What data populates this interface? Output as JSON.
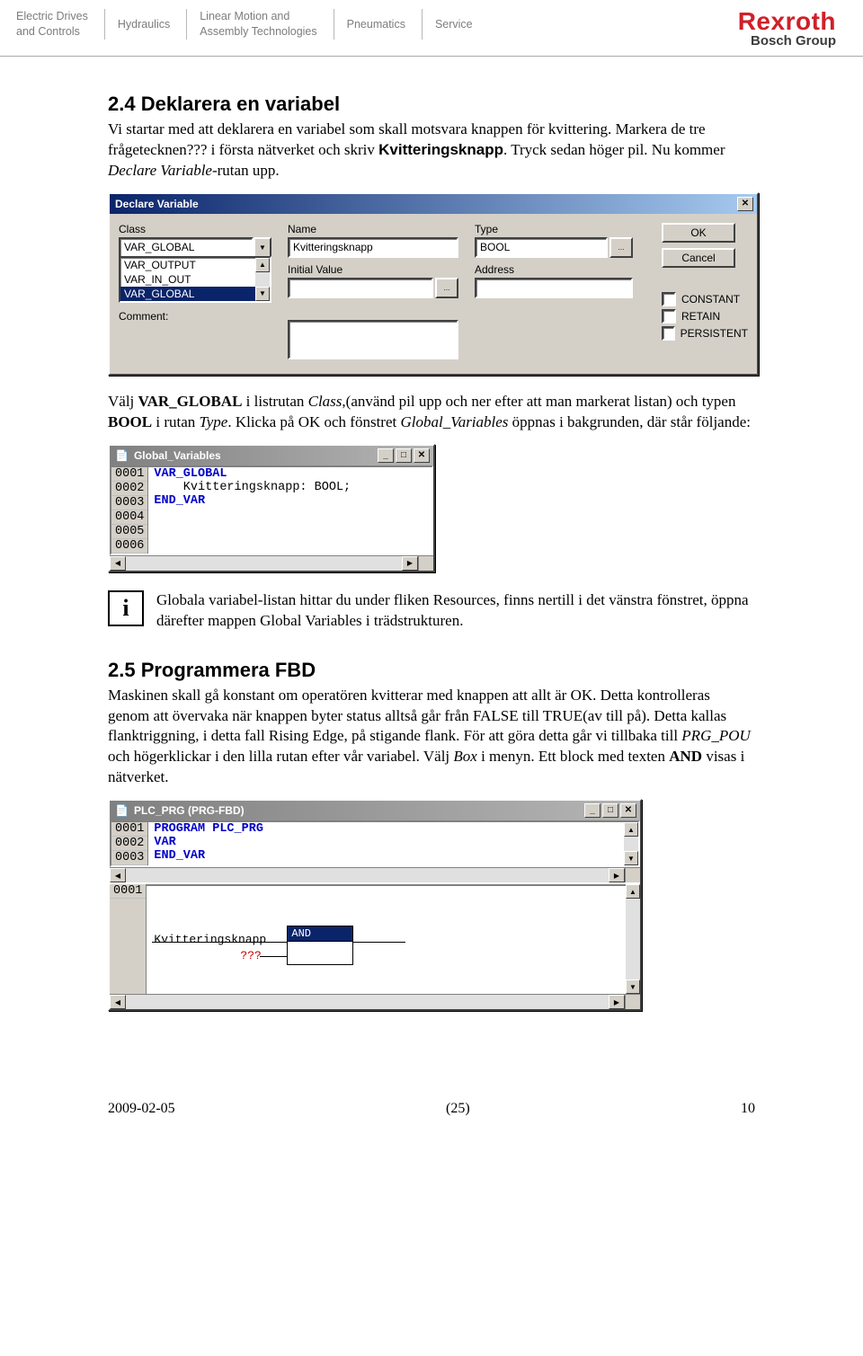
{
  "header": {
    "nav": [
      "Electric Drives\nand Controls",
      "Hydraulics",
      "Linear Motion and\nAssembly Technologies",
      "Pneumatics",
      "Service"
    ],
    "logo_main": "Rexroth",
    "logo_sub": "Bosch Group"
  },
  "section24": {
    "title": "2.4 Deklarera en variabel",
    "p1a": "Vi startar med att deklarera en variabel som skall motsvara knappen för kvittering. Markera de tre frågetecknen??? i första nätverket och skriv ",
    "p1b_bold": "Kvitteringsknapp",
    "p1c": ". Tryck sedan höger pil. Nu kommer ",
    "p1d_italic": "Declare Variable",
    "p1e": "-rutan upp."
  },
  "declare_dialog": {
    "title": "Declare Variable",
    "labels": {
      "class": "Class",
      "name": "Name",
      "type": "Type",
      "initial": "Initial Value",
      "address": "Address",
      "comment": "Comment:"
    },
    "class_value": "VAR_GLOBAL",
    "class_options": [
      "VAR_OUTPUT",
      "VAR_IN_OUT",
      "VAR_GLOBAL"
    ],
    "name_value": "Kvitteringsknapp",
    "type_value": "BOOL",
    "initial_value": "",
    "address_value": "",
    "comment_value": "",
    "btn_ok": "OK",
    "btn_cancel": "Cancel",
    "chk_constant": "CONSTANT",
    "chk_retain": "RETAIN",
    "chk_persistent": "PERSISTENT"
  },
  "after_dialog": {
    "p_a": "Välj ",
    "p_b_bold": "VAR_GLOBAL",
    "p_c": " i listrutan ",
    "p_d_italic": "Class",
    "p_e": ",(använd pil upp och ner efter att man markerat listan) och typen ",
    "p_f_bold": "BOOL",
    "p_g": " i rutan ",
    "p_h_italic": "Type",
    "p_i": ". Klicka på OK och fönstret ",
    "p_j_italic": "Global_Variables",
    "p_k": " öppnas i bakgrunden, där står följande:"
  },
  "gv_window": {
    "title": "Global_Variables",
    "gutter": [
      "0001",
      "0002",
      "0003",
      "0004",
      "0005",
      "0006"
    ],
    "line1": "VAR_GLOBAL",
    "line2": "    Kvitteringsknapp: BOOL;",
    "line3": "END_VAR"
  },
  "info_text": "Globala variabel-listan hittar du under fliken Resources, finns nertill i det vänstra fönstret, öppna därefter mappen Global Variables i trädstrukturen.",
  "section25": {
    "title": "2.5 Programmera FBD",
    "p_a": "Maskinen skall gå konstant om operatören kvitterar med knappen att allt är OK. Detta kontrolleras genom att övervaka när knappen byter status alltså går från FALSE till TRUE(av till på). Detta kallas flanktriggning, i detta fall Rising Edge, på stigande flank. För att göra detta går vi tillbaka till ",
    "p_b_italic": "PRG_POU",
    "p_c": " och högerklickar i den lilla rutan efter vår variabel. Välj ",
    "p_d_italic": "Box",
    "p_e": " i menyn. Ett block med texten ",
    "p_f_bold": "AND",
    "p_g": " visas i nätverket."
  },
  "plc_window": {
    "title": "PLC_PRG (PRG-FBD)",
    "gutter": [
      "0001",
      "0002",
      "0003"
    ],
    "line1": "PROGRAM PLC_PRG",
    "line2": "VAR",
    "line3": "END_VAR",
    "net_num": "0001",
    "var_label": "Kvitteringsknapp",
    "qmarks": "???",
    "block_cap": "AND"
  },
  "footer": {
    "date": "2009-02-05",
    "pages": "(25)",
    "num": "10"
  }
}
